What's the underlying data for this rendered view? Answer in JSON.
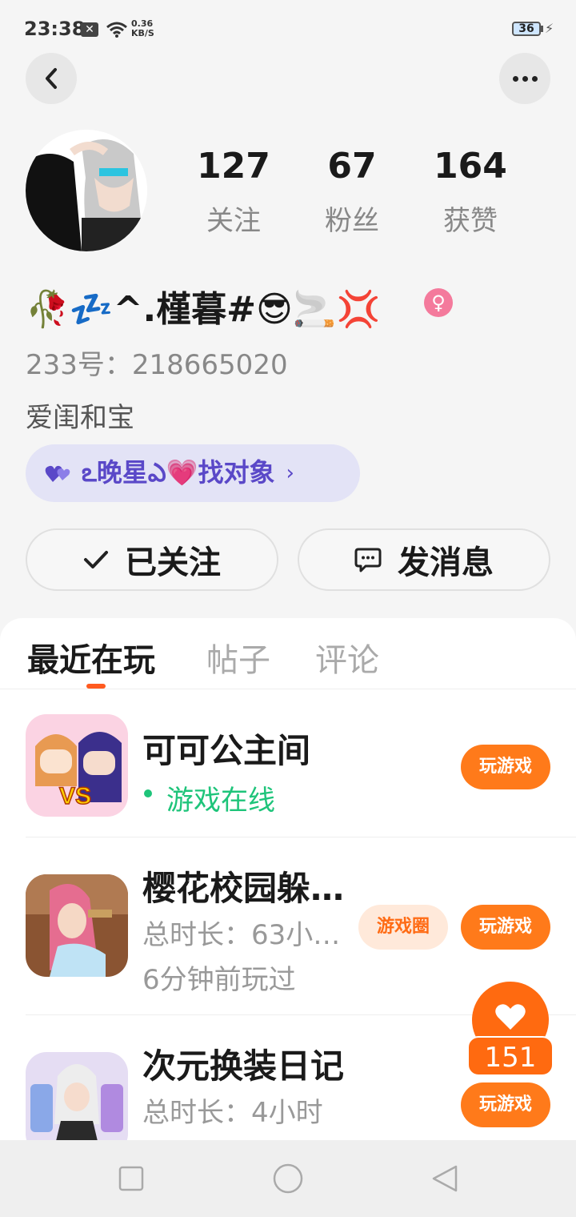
{
  "status": {
    "time": "23:38",
    "speed_value": "0.36",
    "speed_unit": "KB/S",
    "battery": "36"
  },
  "profile": {
    "stats": [
      {
        "value": "127",
        "label": "关注"
      },
      {
        "value": "67",
        "label": "粉丝"
      },
      {
        "value": "164",
        "label": "获赞"
      }
    ],
    "nickname": "🥀💤^.槿暮#😎🚬💢",
    "gender_symbol": "♀",
    "uid": "233号：218665020",
    "signature": "爱闺和宝",
    "cp_label": "ఽ晚星ఎ💗找对象",
    "follow_label": "已关注",
    "message_label": "发消息"
  },
  "tabs": [
    "最近在玩",
    "帖子",
    "评论"
  ],
  "games": [
    {
      "title": "可可公主间",
      "status": "游戏在线",
      "play_label": "玩游戏"
    },
    {
      "title": "樱花校园躲…",
      "duration": "总时长：63小…",
      "last_played": "6分钟前玩过",
      "circle_label": "游戏圈",
      "play_label": "玩游戏"
    },
    {
      "title": "次元换装日记",
      "duration": "总时长：4小时",
      "play_label": "玩游戏"
    }
  ],
  "floating": {
    "like_count": "151"
  },
  "colors": {
    "accent": "#ff7a1a",
    "online": "#1ec47a",
    "cp_text": "#5a48c8",
    "tab_indicator": "#ff5a1f"
  }
}
